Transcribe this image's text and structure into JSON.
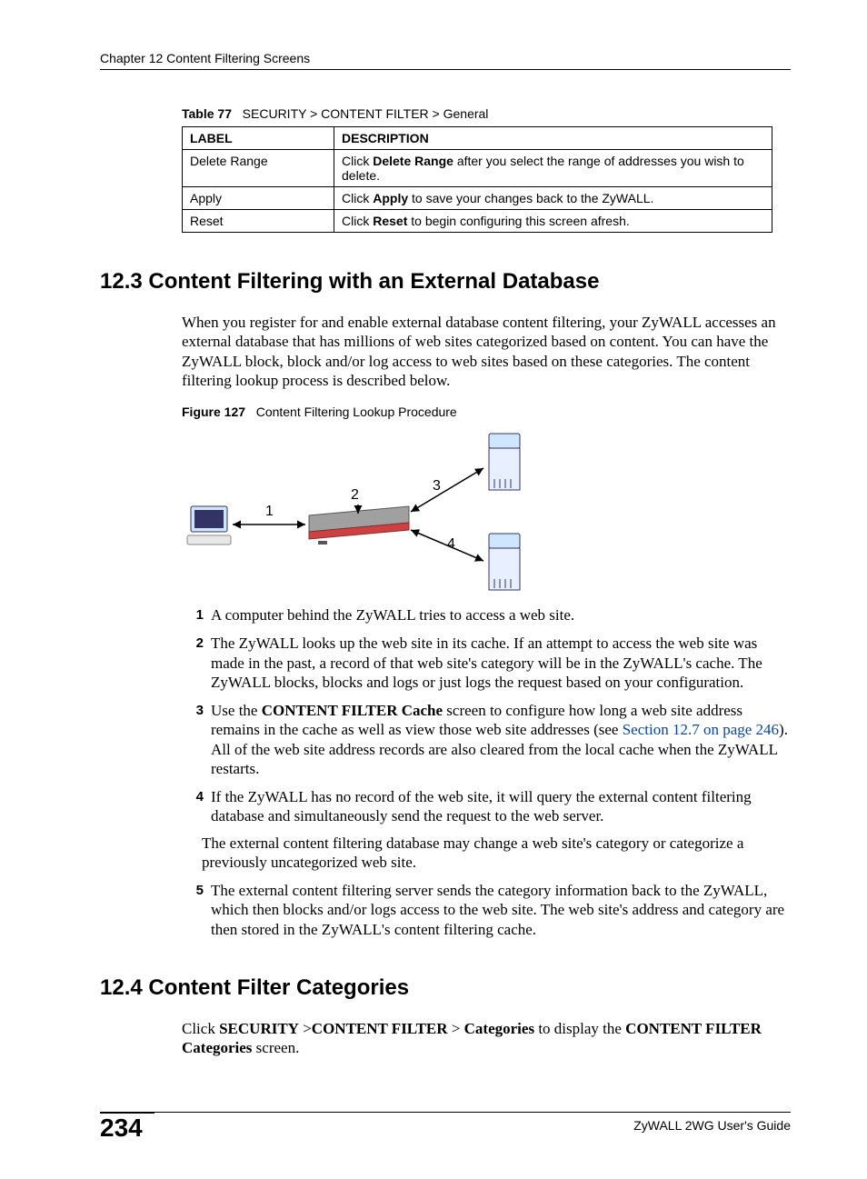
{
  "header": {
    "chapter": "Chapter 12 Content Filtering Screens"
  },
  "table77": {
    "caption_label": "Table 77",
    "caption_text": "SECURITY > CONTENT FILTER > General",
    "headers": {
      "label": "LABEL",
      "description": "DESCRIPTION"
    },
    "rows": [
      {
        "label": "Delete Range",
        "desc_pre": "Click ",
        "desc_bold": "Delete Range",
        "desc_post": " after you select the range of addresses you wish to delete."
      },
      {
        "label": "Apply",
        "desc_pre": "Click ",
        "desc_bold": "Apply",
        "desc_post": " to save your changes back to the ZyWALL."
      },
      {
        "label": "Reset",
        "desc_pre": "Click ",
        "desc_bold": "Reset",
        "desc_post": " to begin configuring this screen afresh."
      }
    ]
  },
  "section123": {
    "heading": "12.3  Content Filtering with an External Database",
    "intro": "When you register for and enable external database content filtering, your ZyWALL accesses an external database that has millions of web sites categorized based on content. You can have the ZyWALL block, block and/or log access to web sites based on these categories. The content filtering lookup process is described below.",
    "figure_label": "Figure 127",
    "figure_text": "Content Filtering Lookup Procedure",
    "diagram_labels": {
      "n1": "1",
      "n2": "2",
      "n3": "3",
      "n4": "4"
    },
    "steps": [
      "A computer behind the ZyWALL tries to access a web site.",
      "The ZyWALL looks up the web site in its cache. If an attempt to access the web site was made in the past, a record of that web site's category will be in the ZyWALL's cache. The ZyWALL blocks, blocks and logs or just logs the request based on your configuration.",
      "STEP3_COMPOSITE",
      "If the ZyWALL has no record of the web site, it will query the external content filtering database and simultaneously send the request to the web server.",
      "The external content filtering server sends the category information back to the ZyWALL, which then blocks and/or logs access to the web site. The web site's address and category are then stored in the ZyWALL's content filtering cache."
    ],
    "step3": {
      "pre": "Use the ",
      "bold1": "CONTENT FILTER Cache",
      "mid1": " screen to configure how long a web site address remains in the cache as well as view those web site addresses (see ",
      "link": "Section 12.7 on page 246",
      "mid2": "). All of the web site address records are also cleared from the local cache when the ZyWALL restarts."
    },
    "note_after_4": "The external content filtering database may change a web site's category or categorize a previously uncategorized web site."
  },
  "section124": {
    "heading": "12.4  Content Filter Categories",
    "intro_pre": "Click ",
    "b1": "SECURITY",
    "gt1": " >",
    "b2": "CONTENT FILTER",
    "gt2": " > ",
    "b3": "Categories",
    "mid": " to display the ",
    "b4": "CONTENT FILTER Categories",
    "post": " screen."
  },
  "footer": {
    "page": "234",
    "guide": "ZyWALL 2WG User's Guide"
  }
}
